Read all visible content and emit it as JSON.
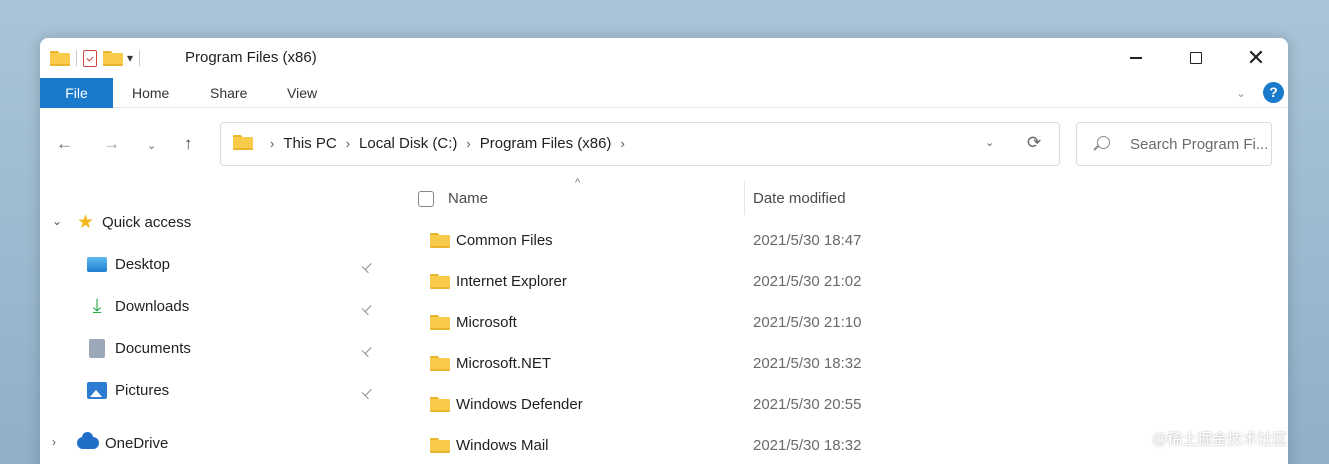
{
  "window": {
    "title": "Program Files (x86)",
    "controls": {
      "minimize": "—",
      "maximize": "☐",
      "close": "✕"
    }
  },
  "quick_access_toolbar": {
    "icons": [
      "folder-icon",
      "properties-icon",
      "new-folder-icon"
    ],
    "chevron": "▾"
  },
  "ribbon": {
    "tabs": [
      {
        "label": "File",
        "active": true,
        "color": "#1979ca"
      },
      {
        "label": "Home"
      },
      {
        "label": "Share"
      },
      {
        "label": "View"
      }
    ],
    "expand_icon": "⌄",
    "help": "?"
  },
  "navigation": {
    "back": "←",
    "forward": "→",
    "recent": "⌄",
    "up": "↑",
    "breadcrumb": [
      "This PC",
      "Local Disk (C:)",
      "Program Files (x86)"
    ],
    "crumb_separator": "›",
    "dropdown": "⌄",
    "refresh": "⟳",
    "search_placeholder": "Search Program Fi..."
  },
  "nav_pane": {
    "quick_access": {
      "label": "Quick access",
      "expanded": true,
      "chevron": "⌄"
    },
    "items": [
      {
        "label": "Desktop",
        "icon": "desktop-icon",
        "pinned": true
      },
      {
        "label": "Downloads",
        "icon": "downloads-icon",
        "pinned": true
      },
      {
        "label": "Documents",
        "icon": "documents-icon",
        "pinned": true
      },
      {
        "label": "Pictures",
        "icon": "pictures-icon",
        "pinned": true
      }
    ],
    "onedrive": {
      "label": "OneDrive",
      "expanded": false,
      "chevron": "›"
    },
    "pin_glyph": "📌"
  },
  "file_list": {
    "columns": {
      "name": "Name",
      "date_modified": "Date modified"
    },
    "sort_indicator": "^",
    "rows": [
      {
        "name": "Common Files",
        "date": "2021/5/30 18:47"
      },
      {
        "name": "Internet Explorer",
        "date": "2021/5/30 21:02"
      },
      {
        "name": "Microsoft",
        "date": "2021/5/30 21:10"
      },
      {
        "name": "Microsoft.NET",
        "date": "2021/5/30 18:32"
      },
      {
        "name": "Windows Defender",
        "date": "2021/5/30 20:55"
      },
      {
        "name": "Windows Mail",
        "date": "2021/5/30 18:32"
      }
    ]
  },
  "watermark": "@稀土掘金技术社区"
}
